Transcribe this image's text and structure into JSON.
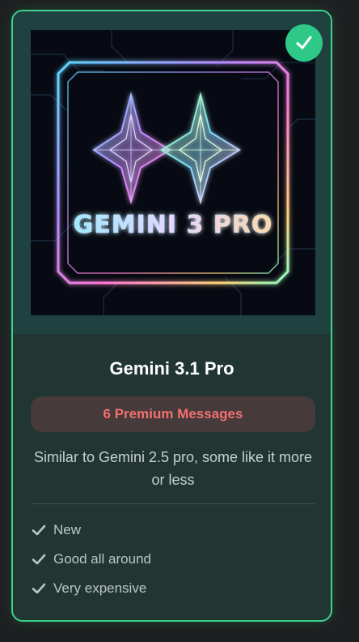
{
  "card": {
    "artwork_text": "GEMINI 3 PRO",
    "selected_icon": "checkmark-icon",
    "title": "Gemini 3.1 Pro",
    "cost_label": "6 Premium Messages",
    "description": "Similar to Gemini 2.5 pro, some like it more or less",
    "features": [
      {
        "label": "New",
        "icon": "checkmark-icon"
      },
      {
        "label": "Good all around",
        "icon": "checkmark-icon"
      },
      {
        "label": "Very expensive",
        "icon": "checkmark-icon"
      }
    ]
  },
  "colors": {
    "accent": "#3fd08c",
    "card_bg": "#213632",
    "cost_bg": "#473a3a",
    "cost_text": "#f07070"
  }
}
